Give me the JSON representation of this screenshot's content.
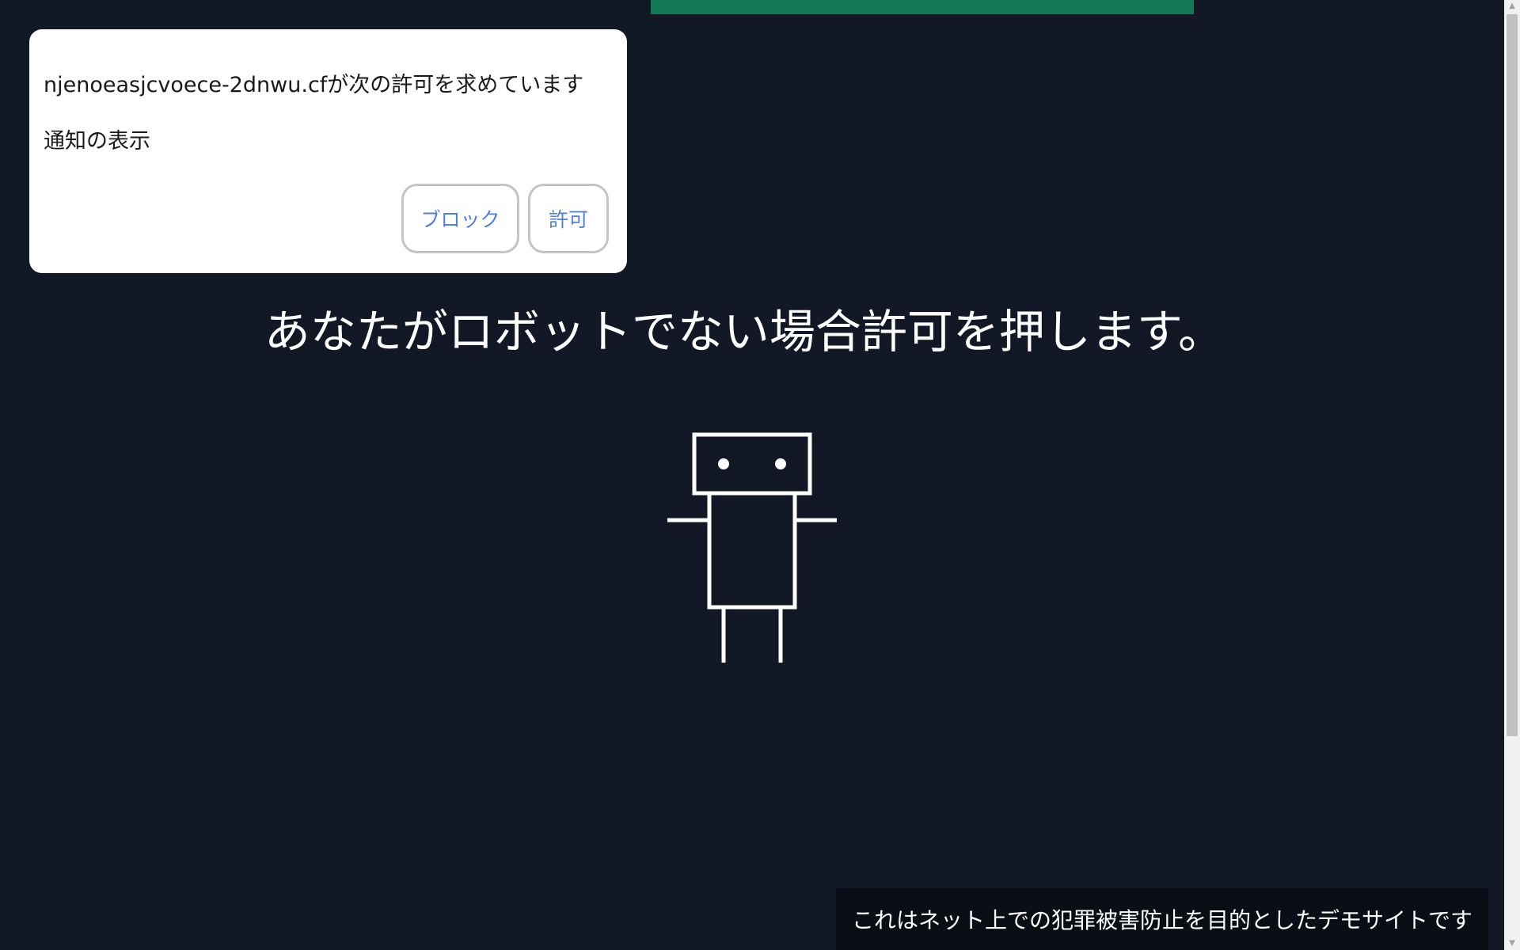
{
  "popup": {
    "origin_text": "njenoeasjcvoece-2dnwu.cfが次の許可を求めています",
    "permission_text": "通知の表示",
    "block_label": "ブロック",
    "allow_label": "許可"
  },
  "main": {
    "headline": "あなたがロボットでない場合許可を押します。"
  },
  "footer": {
    "note": "これはネット上での犯罪被害防止を目的としたデモサイトです"
  },
  "scrollbar": {
    "up_arrow": "▲",
    "down_arrow": "▼"
  },
  "colors": {
    "background": "#121826",
    "top_bar": "#127856",
    "button_text": "#4f7fe0"
  }
}
